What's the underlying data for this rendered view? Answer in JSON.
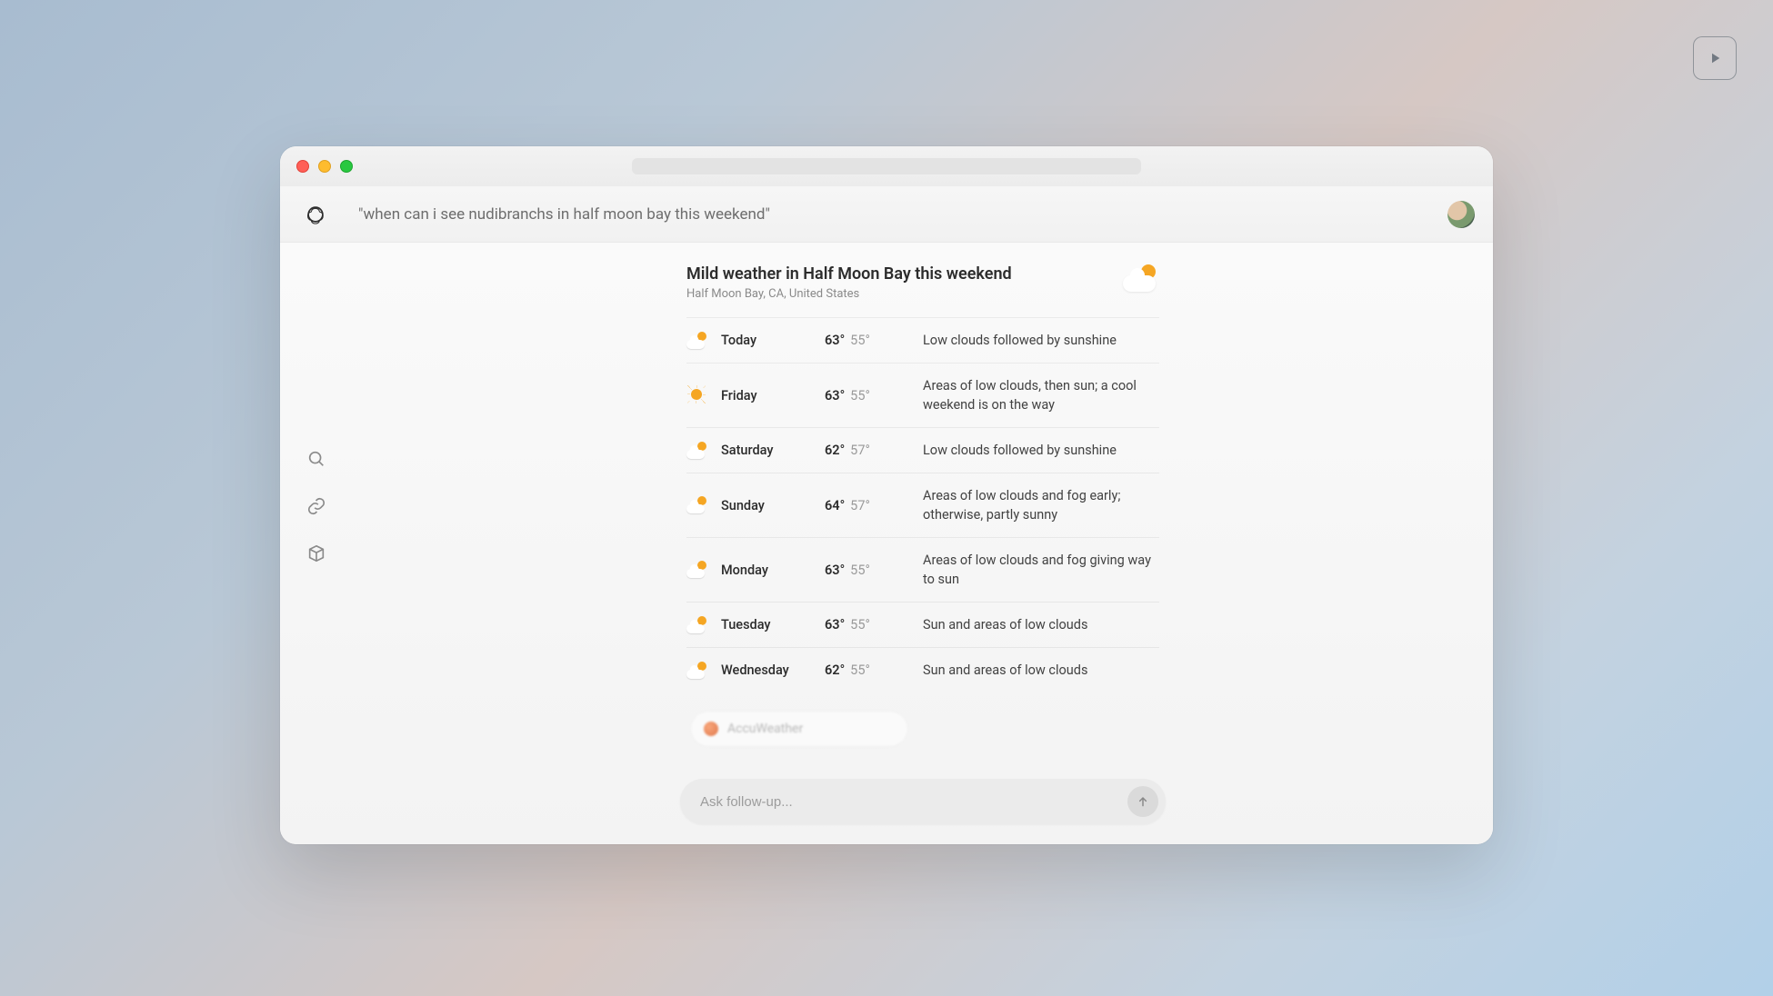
{
  "query": "\"when can i see nudibranchs in half moon bay this weekend\"",
  "avatar_alt": "User avatar",
  "play_button_alt": "Play",
  "followup": {
    "placeholder": "Ask follow-up..."
  },
  "weather": {
    "title": "Mild weather in Half Moon Bay this weekend",
    "location": "Half Moon Bay, CA, United States",
    "hero_icon": "partly-cloudy",
    "source_chip_label": "AccuWeather",
    "forecast": [
      {
        "day": "Today",
        "icon": "partly-cloudy",
        "hi": "63°",
        "lo": "55°",
        "desc": "Low clouds followed by sunshine"
      },
      {
        "day": "Friday",
        "icon": "sunny",
        "hi": "63°",
        "lo": "55°",
        "desc": "Areas of low clouds, then sun; a cool weekend is on the way"
      },
      {
        "day": "Saturday",
        "icon": "partly-cloudy",
        "hi": "62°",
        "lo": "57°",
        "desc": "Low clouds followed by sunshine"
      },
      {
        "day": "Sunday",
        "icon": "partly-cloudy",
        "hi": "64°",
        "lo": "57°",
        "desc": "Areas of low clouds and fog early; otherwise, partly sunny"
      },
      {
        "day": "Monday",
        "icon": "partly-cloudy",
        "hi": "63°",
        "lo": "55°",
        "desc": "Areas of low clouds and fog giving way to sun"
      },
      {
        "day": "Tuesday",
        "icon": "partly-cloudy",
        "hi": "63°",
        "lo": "55°",
        "desc": "Sun and areas of low clouds"
      },
      {
        "day": "Wednesday",
        "icon": "partly-cloudy",
        "hi": "62°",
        "lo": "55°",
        "desc": "Sun and areas of low clouds"
      }
    ]
  },
  "sidebar_icons": [
    "search",
    "link",
    "package"
  ]
}
